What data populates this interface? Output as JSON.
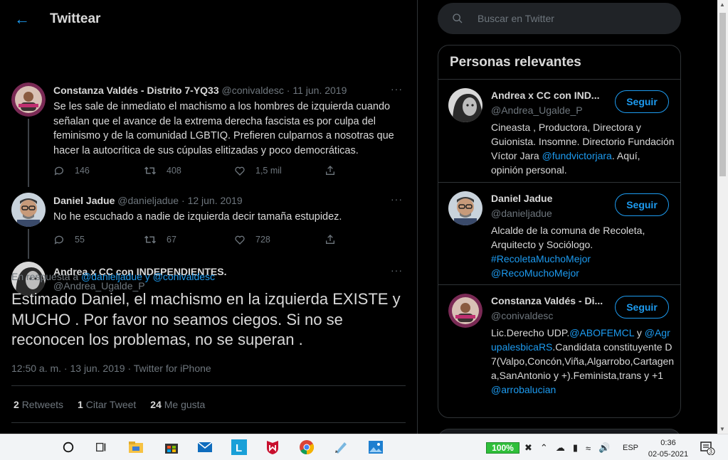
{
  "header": {
    "title": "Twittear"
  },
  "tweets": [
    {
      "name": "Constanza Valdés - Distrito 7-YQ33",
      "handle": "@conivaldesc",
      "date": "11 jun. 2019",
      "text": "Se les sale de inmediato el machismo a los hombres de izquierda cuando señalan que el avance de la extrema derecha fascista es por culpa del feminismo y de la comunidad LGBTIQ. Prefieren culparnos a nosotras que hacer la autocrítica de sus cúpulas elitizadas y poco democráticas.",
      "replies": "146",
      "retweets": "408",
      "likes": "1,5 mil"
    },
    {
      "name": "Daniel Jadue",
      "handle": "@danieljadue",
      "date": "12 jun. 2019",
      "text": "No he escuchado a nadie de izquierda decir tamaña estupidez.",
      "replies": "55",
      "retweets": "67",
      "likes": "728"
    }
  ],
  "main_tweet": {
    "name": "Andrea x CC con INDEPENDIENTES.",
    "handle": "@Andrea_Ugalde_P",
    "reply_prefix": "En respuesta a",
    "reply_to_1": "@danieljadue",
    "reply_joiner": "y",
    "reply_to_2": "@conivaldesc",
    "text": "Estimado Daniel, el machismo en la izquierda EXISTE y MUCHO . Por favor no seamos ciegos. Si no se reconocen los problemas, no se superan .",
    "timestamp": "12:50 a. m. · 13 jun. 2019 · Twitter for iPhone",
    "retweets_count": "2",
    "retweets_label": "Retweets",
    "quotes_count": "1",
    "quotes_label": "Citar Tweet",
    "likes_count": "24",
    "likes_label": "Me gusta"
  },
  "more_label": "···",
  "search": {
    "placeholder": "Buscar en Twitter"
  },
  "relevant": {
    "title": "Personas relevantes",
    "follow_label": "Seguir",
    "people": [
      {
        "name": "Andrea x CC con IND...",
        "handle": "@Andrea_Ugalde_P",
        "bio_text": "Cineasta , Productora, Directora y Guionista. Insomne. Directorio Fundación Víctor Jara ",
        "bio_link": "@fundvictorjara",
        "bio_tail": ". Aquí, opinión personal."
      },
      {
        "name": "Daniel Jadue",
        "handle": "@danieljadue",
        "bio_text": "Alcalde de la comuna de Recoleta, Arquitecto y Sociólogo. ",
        "bio_link": "#RecoletaMuchoMejor",
        "bio_link2": "@RecoMuchoMejor"
      },
      {
        "name": "Constanza Valdés - Di...",
        "handle": "@conivaldesc",
        "bio_text": "Lic.Derecho UDP.",
        "bio_link": "@ABOFEMCL",
        "bio_mid": " y ",
        "bio_link2": "@AgrupalesbicaRS",
        "bio_tail": ".Candidata constituyente D7(Valpo,Concón,Viña,Algarrobo,Cartagena,SanAntonio y +).Feminista,trans y +1 ",
        "bio_link3": "@arrobalucian"
      }
    ]
  },
  "taskbar": {
    "battery": "100%",
    "lang": "ESP",
    "time": "0:36",
    "date": "02-05-2021",
    "notifications": "3"
  },
  "colors": {
    "accent": "#1d9bf0",
    "background": "#000000",
    "secondary_text": "#6e767d"
  }
}
